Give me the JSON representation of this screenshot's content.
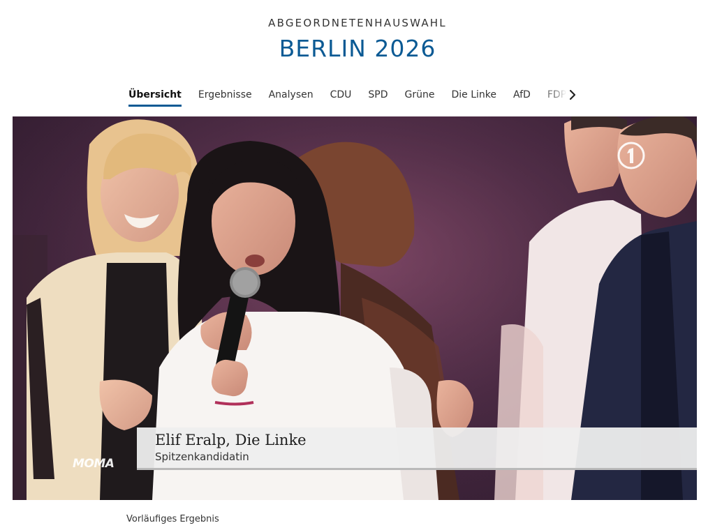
{
  "header": {
    "kicker": "ABGEORDNETENHAUSWAHL",
    "title": "BERLIN 2026"
  },
  "tabs": [
    {
      "label": "Übersicht",
      "active": true
    },
    {
      "label": "Ergebnisse"
    },
    {
      "label": "Analysen"
    },
    {
      "label": "CDU"
    },
    {
      "label": "SPD"
    },
    {
      "label": "Grüne"
    },
    {
      "label": "Die Linke"
    },
    {
      "label": "AfD"
    },
    {
      "label": "FDP"
    }
  ],
  "tabs_next_icon": "chevron-right-icon",
  "video": {
    "channel_logo_icon": "ard-one-icon",
    "show_logo": "MOMA",
    "lower_third": {
      "name": "Elif Eralp, Die Linke",
      "role": "Spitzenkandidatin"
    }
  },
  "caption": "Vorläufiges Ergebnis",
  "colors": {
    "accent": "#0b5a94",
    "text": "#222222",
    "lower_third_bg": "#eeeeee"
  }
}
